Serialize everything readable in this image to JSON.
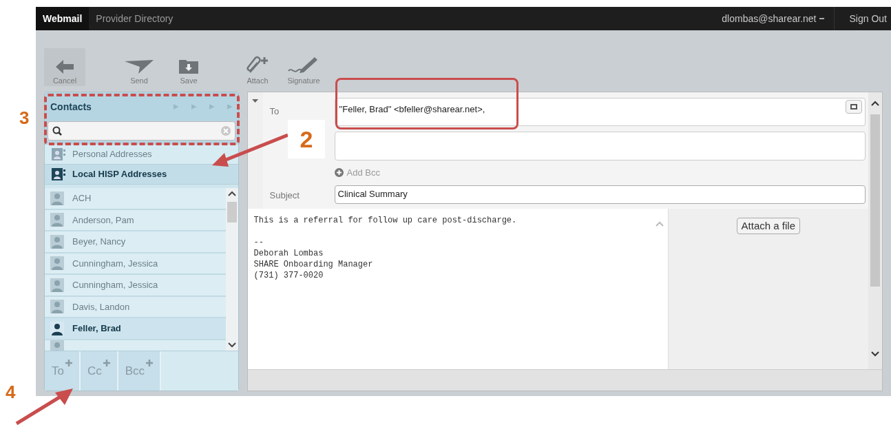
{
  "topbar": {
    "tabs": [
      {
        "label": "Webmail",
        "selected": true
      },
      {
        "label": "Provider Directory",
        "selected": false
      }
    ],
    "user": "dlombas@sharear.net",
    "sign_out": "Sign Out"
  },
  "toolbar": [
    {
      "label": "Cancel",
      "kind": "cancel"
    },
    {
      "label": "Send",
      "kind": "send"
    },
    {
      "label": "Save",
      "kind": "save"
    },
    {
      "label": "Attach",
      "kind": "attach"
    },
    {
      "label": "Signature",
      "kind": "signature"
    }
  ],
  "contacts": {
    "title": "Contacts",
    "address_books": [
      {
        "label": "Personal Addresses",
        "selected": false
      },
      {
        "label": "Local HISP Addresses",
        "selected": true
      }
    ],
    "items": [
      {
        "name": "ACH",
        "selected": false
      },
      {
        "name": "Anderson, Pam",
        "selected": false
      },
      {
        "name": "Beyer, Nancy",
        "selected": false
      },
      {
        "name": "Cunningham, Jessica",
        "selected": false
      },
      {
        "name": "Cunningham, Jessica",
        "selected": false
      },
      {
        "name": "Davis, Landon",
        "selected": false
      },
      {
        "name": "Feller, Brad",
        "selected": true
      }
    ],
    "add_buttons": [
      "To",
      "Cc",
      "Bcc"
    ]
  },
  "compose": {
    "to": {
      "label": "To",
      "value": "\"Feller, Brad\" <bfeller@sharear.net>,"
    },
    "add_bcc": "Add Bcc",
    "subject": {
      "label": "Subject",
      "value": "Clinical Summary"
    },
    "body": "This is a referral for follow up care post-discharge.\n\n--\nDeborah Lombas\nSHARE Onboarding Manager\n(731) 377-0020",
    "attach_button": "Attach a file"
  },
  "annotations": [
    {
      "label": "3",
      "kind": "contacts"
    },
    {
      "label": "2",
      "kind": "addresses"
    },
    {
      "label": "4",
      "kind": "add"
    }
  ]
}
